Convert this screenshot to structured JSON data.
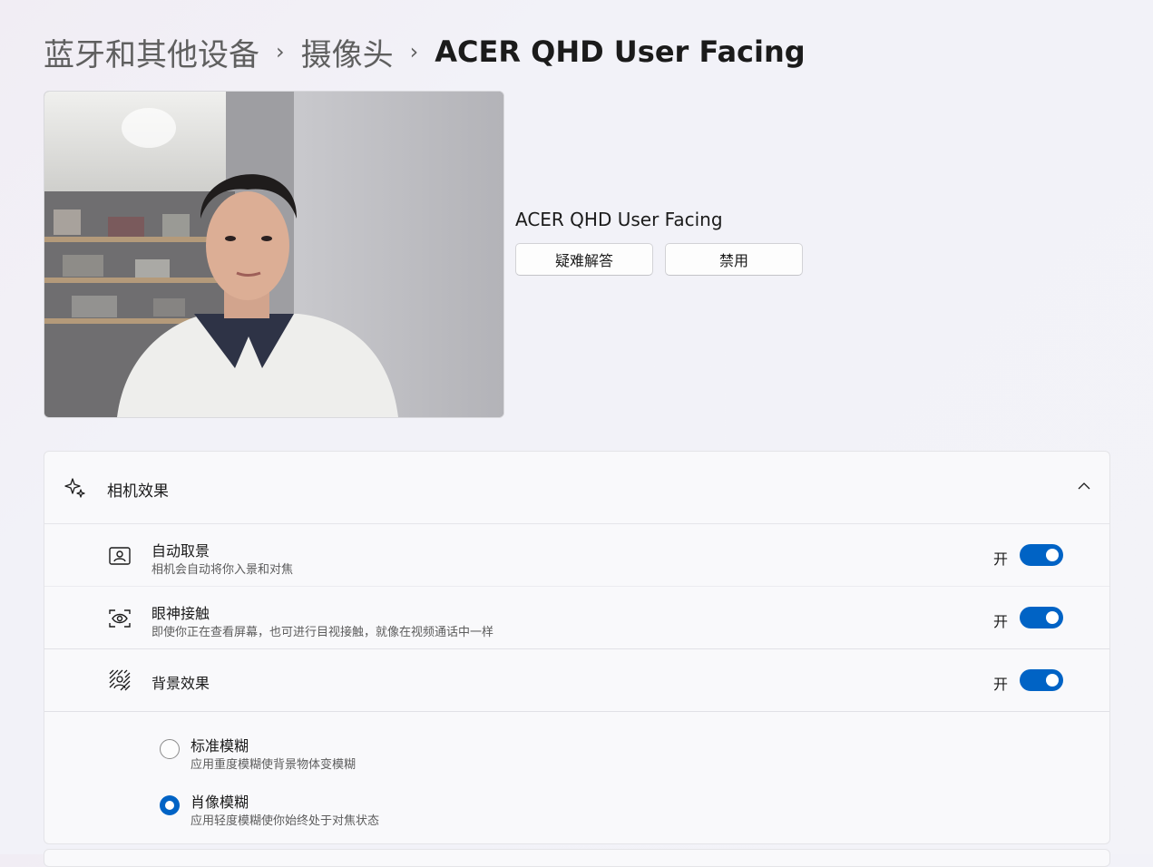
{
  "breadcrumb": {
    "items": [
      "蓝牙和其他设备",
      "摄像头"
    ],
    "current": "ACER QHD User Facing",
    "separator": "›"
  },
  "camera": {
    "preview_icon": "camera-preview-image",
    "name": "ACER QHD User Facing",
    "troubleshoot_label": "疑难解答",
    "disable_label": "禁用"
  },
  "effects": {
    "title": "相机效果",
    "icon": "sparkle-icon",
    "expanded": true,
    "items": [
      {
        "icon": "auto-framing-icon",
        "title": "自动取景",
        "subtitle": "相机会自动将你入景和对焦",
        "state_label": "开",
        "on": true
      },
      {
        "icon": "eye-contact-icon",
        "title": "眼神接触",
        "subtitle": "即使你正在查看屏幕，也可进行目视接触，就像在视频通话中一样",
        "state_label": "开",
        "on": true
      },
      {
        "icon": "background-effects-icon",
        "title": "背景效果",
        "state_label": "开",
        "on": true
      }
    ],
    "blur_options": [
      {
        "title": "标准模糊",
        "subtitle": "应用重度模糊使背景物体变模糊",
        "selected": false
      },
      {
        "title": "肖像模糊",
        "subtitle": "应用轻度模糊使你始终处于对焦状态",
        "selected": true
      }
    ]
  },
  "colors": {
    "accent": "#0063c5",
    "background": "#f3f3f8",
    "card": "#f9f9fb"
  }
}
